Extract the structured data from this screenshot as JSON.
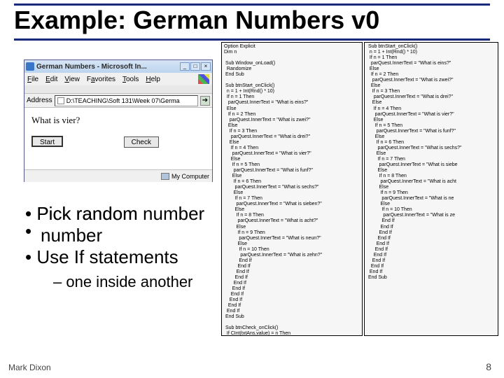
{
  "slide": {
    "title": "Example: German Numbers v0",
    "footer_author": "Mark Dixon",
    "footer_page": "8"
  },
  "browser": {
    "title": "German Numbers - Microsoft In...",
    "menu": {
      "file": "File",
      "edit": "Edit",
      "view": "View",
      "favorites": "Favorites",
      "tools": "Tools",
      "help": "Help"
    },
    "address_label": "Address",
    "address_value": "D:\\TEACHING\\Soft 131\\Week 07\\Germa",
    "question": "What is vier?",
    "btn_start": "Start",
    "btn_check": "Check",
    "status_text": "My Computer"
  },
  "bullets": {
    "b1": "Pick random number",
    "b2": "Use If statements",
    "sub1": "one inside another"
  },
  "code_left": "Option Explicit\nDim n\n\n Sub Window_onLoad()\n  Randomize\n End Sub\n\n Sub btnStart_onClick()\n  n = 1 + Int(Rnd() * 10)\n  If n = 1 Then\n   parQuest.InnerText = \"What is eins?\"\n  Else\n   If n = 2 Then\n    parQuest.InnerText = \"What is zwei?\"\n   Else\n    If n = 3 Then\n     parQuest.InnerText = \"What is drei?\"\n    Else\n     If n = 4 Then\n      parQuest.InnerText = \"What is vier?\"\n     Else\n      If n = 5 Then\n       parQuest.InnerText = \"What is funf?\"\n      Else\n       If n = 6 Then\n        parQuest.InnerText = \"What is sechs?\"\n       Else\n        If n = 7 Then\n         parQuest.InnerText = \"What is sieben?\"\n        Else\n         If n = 8 Then\n          parQuest.InnerText = \"What is acht?\"\n         Else\n          If n = 9 Then\n           parQuest.InnerText = \"What is neun?\"\n          Else\n           If n = 10 Then\n            parQuest.InnerText = \"What is zehn?\"\n           End If\n          End If\n         End If\n        End If\n       End If\n      End If\n     End If\n    End If\n   End If\n  End If\n End Sub\n\n Sub btnCheck_onClick()\n  If CInt(txtAns.value) = n Then\n   parRes.InnerText = \"Correct!\"\n  Else\n   parRes.InnerText = \"Sorry, please try again.\" & n\n  End If\n End Sub",
  "code_right": " Sub btnStart_onClick()\n  n = 1 + Int(Rnd() * 10)\n  If n = 1 Then\n   parQuest.InnerText = \"What is eins?\"\n  Else\n   If n = 2 Then\n    parQuest.InnerText = \"What is zwei?\"\n   Else\n    If n = 3 Then\n     parQuest.InnerText = \"What is drei?\"\n    Else\n     If n = 4 Then\n      parQuest.InnerText = \"What is vier?\"\n     Else\n      If n = 5 Then\n       parQuest.InnerText = \"What is funf?\"\n      Else\n       If n = 6 Then\n        parQuest.InnerText = \"What is sechs?\"\n       Else\n        If n = 7 Then\n         parQuest.InnerText = \"What is siebe\n        Else\n         If n = 8 Then\n          parQuest.InnerText = \"What is acht\n         Else\n          If n = 9 Then\n           parQuest.InnerText = \"What is ne\n          Else\n           If n = 10 Then\n            parQuest.InnerText = \"What is ze\n           End If\n          End If\n         End If\n        End If\n       End If\n      End If\n     End If\n    End If\n   End If\n  End If\n End Sub"
}
